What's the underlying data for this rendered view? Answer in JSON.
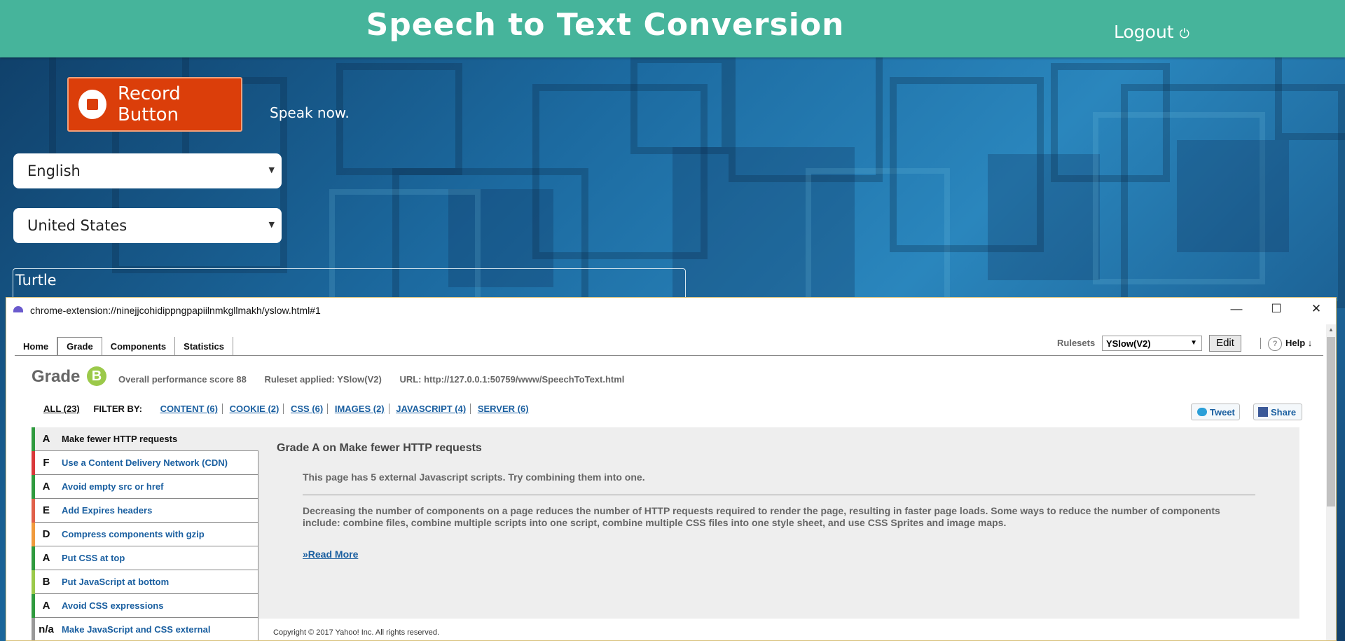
{
  "header": {
    "title": "Speech to Text Conversion",
    "logout_label": "Logout",
    "logout_icon": "power-icon"
  },
  "recorder": {
    "record_label": "Record Button",
    "status": "Speak now.",
    "language": "English",
    "dialect": "United States",
    "transcript": "Turtle"
  },
  "window": {
    "url": "chrome-extension://ninejjcohidippngpapiilnmkgllmakh/yslow.html#1",
    "minimize": "—",
    "maximize": "☐",
    "close": "✕"
  },
  "tabs": [
    {
      "label": "Home"
    },
    {
      "label": "Grade"
    },
    {
      "label": "Components"
    },
    {
      "label": "Statistics"
    }
  ],
  "toolbar": {
    "rulesets_label": "Rulesets",
    "ruleset_value": "YSlow(V2)",
    "edit_label": "Edit",
    "help_q": "?",
    "help_label": "Help ↓"
  },
  "grade": {
    "label": "Grade",
    "letter": "B",
    "score_text": "Overall performance score 88",
    "ruleset_text": "Ruleset applied: YSlow(V2)",
    "url_text": "URL: http://127.0.0.1:50759/www/SpeechToText.html",
    "color": "#9bc94a"
  },
  "filter": {
    "all": "ALL (23)",
    "filter_by": "FILTER BY:",
    "items": [
      {
        "label": "CONTENT (6)"
      },
      {
        "label": "COOKIE (2)"
      },
      {
        "label": "CSS (6)"
      },
      {
        "label": "IMAGES (2)"
      },
      {
        "label": "JAVASCRIPT (4)"
      },
      {
        "label": "SERVER (6)"
      }
    ]
  },
  "social": {
    "tweet": "Tweet",
    "share": "Share"
  },
  "rules": [
    {
      "grade": "A",
      "name": "Make fewer HTTP requests",
      "color": "#2f9a3e"
    },
    {
      "grade": "F",
      "name": "Use a Content Delivery Network (CDN)",
      "color": "#d9383a"
    },
    {
      "grade": "A",
      "name": "Avoid empty src or href",
      "color": "#2f9a3e"
    },
    {
      "grade": "E",
      "name": "Add Expires headers",
      "color": "#e0604a"
    },
    {
      "grade": "D",
      "name": "Compress components with gzip",
      "color": "#f09a3c"
    },
    {
      "grade": "A",
      "name": "Put CSS at top",
      "color": "#2f9a3e"
    },
    {
      "grade": "B",
      "name": "Put JavaScript at bottom",
      "color": "#9bc94a"
    },
    {
      "grade": "A",
      "name": "Avoid CSS expressions",
      "color": "#2f9a3e"
    },
    {
      "grade": "n/a",
      "name": "Make JavaScript and CSS external",
      "color": "#999999"
    }
  ],
  "detail": {
    "heading": "Grade A on Make fewer HTTP requests",
    "summary": "This page has 5 external Javascript scripts. Try combining them into one.",
    "body": "Decreasing the number of components on a page reduces the number of HTTP requests required to render the page, resulting in faster page loads. Some ways to reduce the number of components include: combine files, combine multiple scripts into one script, combine multiple CSS files into one style sheet, and use CSS Sprites and image maps.",
    "read_more": "»Read More"
  },
  "copyright": "Copyright © 2017 Yahoo! Inc. All rights reserved."
}
